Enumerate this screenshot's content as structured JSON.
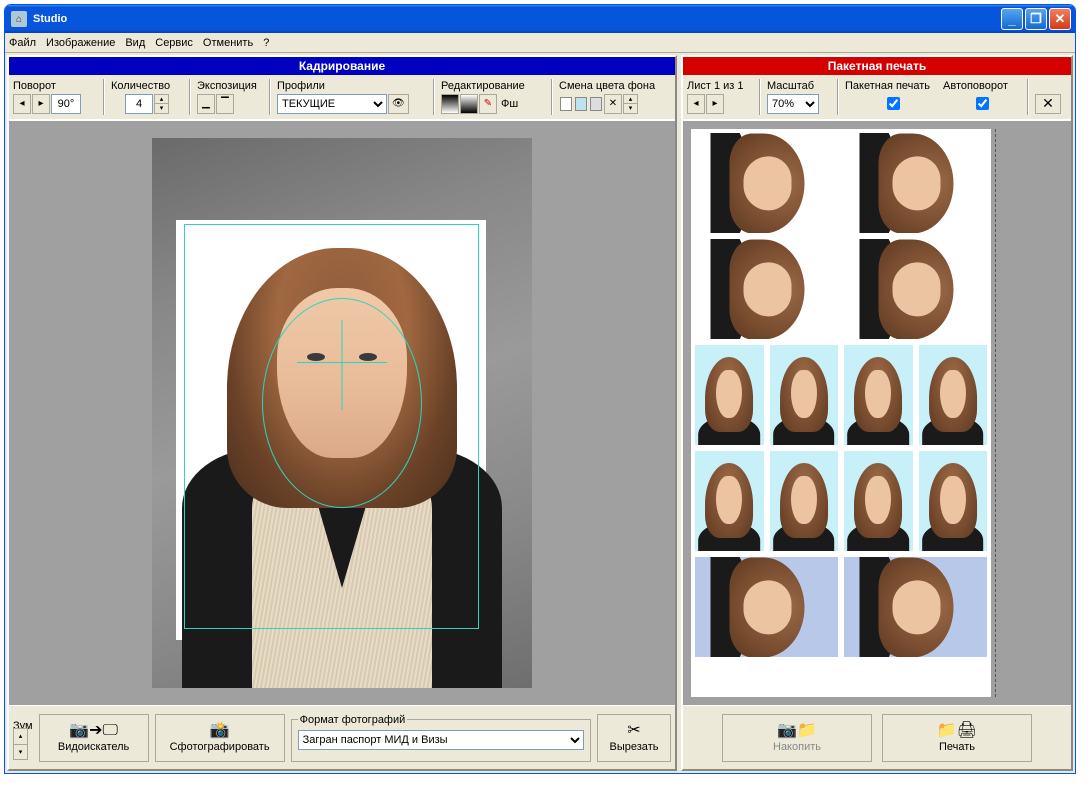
{
  "titlebar": {
    "app_title": "Studio"
  },
  "menubar": {
    "file": "Файл",
    "image": "Изображение",
    "view": "Вид",
    "service": "Сервис",
    "undo": "Отменить",
    "help": "?"
  },
  "crop_panel": {
    "header": "Кадрирование",
    "rotate_label": "Поворот",
    "rotate_value": "90°",
    "quantity_label": "Количество",
    "quantity_value": "4",
    "exposure_label": "Экспозиция",
    "profiles_label": "Профили",
    "profiles_value": "ТЕКУЩИЕ",
    "edit_label": "Редактирование",
    "edit_fsh": "Фш",
    "bgcolor_label": "Смена цвета фона"
  },
  "print_panel": {
    "header": "Пакетная печать",
    "sheet_label": "Лист 1 из 1",
    "scale_label": "Масштаб",
    "scale_value": "70%",
    "batch_label": "Пакетная печать",
    "autorotate_label": "Автоповорот"
  },
  "bottom_left": {
    "zoom_label": "Зум",
    "viewfinder_label": "Видоискатель",
    "shoot_label": "Сфотографировать",
    "format_group": "Формат фотографий",
    "format_value": "Загран паспорт МИД и Визы",
    "cut_label": "Вырезать"
  },
  "bottom_right": {
    "accumulate_label": "Накопить",
    "print_label": "Печать"
  },
  "colors": {
    "header_blue": "#0000c0",
    "header_red": "#d40000",
    "crop_guide": "#2dd4bf"
  }
}
